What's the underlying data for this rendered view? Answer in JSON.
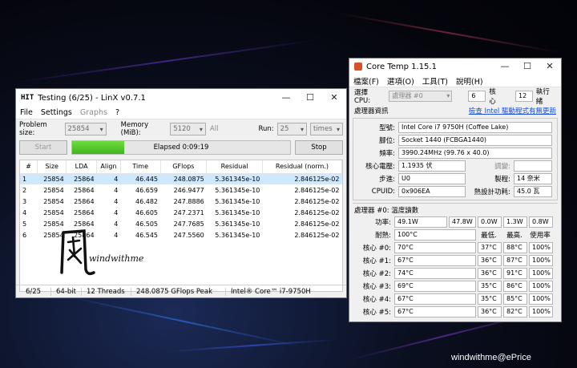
{
  "linx": {
    "title": "Testing (6/25) - LinX v0.7.1",
    "app_icon": "HIT",
    "menu": [
      "File",
      "Settings",
      "Graphs",
      "?"
    ],
    "problem_size_label": "Problem size:",
    "problem_size_value": "25854",
    "memory_label": "Memory (MiB):",
    "memory_value": "5120",
    "all_label": "All",
    "run_label": "Run:",
    "run_value": "25",
    "run_unit": "times",
    "start_label": "Start",
    "stop_label": "Stop",
    "elapsed": "Elapsed 0:09:19",
    "progress_fraction": 0.24,
    "columns": [
      "#",
      "Size",
      "LDA",
      "Align",
      "Time",
      "GFlops",
      "Residual",
      "Residual (norm.)"
    ],
    "rows": [
      [
        "1",
        "25854",
        "25864",
        "4",
        "46.445",
        "248.0875",
        "5.361345e-10",
        "2.846125e-02"
      ],
      [
        "2",
        "25854",
        "25864",
        "4",
        "46.659",
        "246.9477",
        "5.361345e-10",
        "2.846125e-02"
      ],
      [
        "3",
        "25854",
        "25864",
        "4",
        "46.482",
        "247.8886",
        "5.361345e-10",
        "2.846125e-02"
      ],
      [
        "4",
        "25854",
        "25864",
        "4",
        "46.605",
        "247.2371",
        "5.361345e-10",
        "2.846125e-02"
      ],
      [
        "5",
        "25854",
        "25864",
        "4",
        "46.505",
        "247.7685",
        "5.361345e-10",
        "2.846125e-02"
      ],
      [
        "6",
        "25854",
        "25864",
        "4",
        "46.545",
        "247.5560",
        "5.361345e-10",
        "2.846125e-02"
      ]
    ],
    "watermark_text": "windwithme",
    "status": [
      "6/25",
      "64-bit",
      "12 Threads",
      "248.0875 GFlops Peak",
      "Intel® Core™ i7-9750H"
    ]
  },
  "coretemp": {
    "title": "Core Temp 1.15.1",
    "menu": [
      "檔案(F)",
      "選項(O)",
      "工具(T)",
      "說明(H)"
    ],
    "select_cpu_label": "選擇 CPU:",
    "processor_select": "處理器 #0",
    "cores_value": "6",
    "cores_label": "核心",
    "threads_value": "12",
    "threads_label": "執行緒",
    "info_title": "處理器資訊",
    "driver_link": "檢查 Intel 驅動程式有無更新",
    "model_label": "型號:",
    "model_value": "Intel Core i7 9750H (Coffee Lake)",
    "platform_label": "腳位:",
    "platform_value": "Socket 1440 (FCBGA1440)",
    "frequency_label": "頻率:",
    "frequency_value": "3990.24MHz (99.76 x 40.0)",
    "vid_label": "核心電壓:",
    "vid_value": "1.1935 伏",
    "modulation_label": "調變:",
    "modulation_value": "",
    "revision_label": "步進:",
    "revision_value": "U0",
    "lithography_label": "製程:",
    "lithography_value": "14 奈米",
    "cpuid_label": "CPUID:",
    "cpuid_value": "0x906EA",
    "tdp_label": "熱設計功耗:",
    "tdp_value": "45.0 瓦",
    "temp_title": "處理器 #0: 溫度讀數",
    "power_label": "功率:",
    "power_values": [
      "49.1W",
      "47.8W",
      "0.0W",
      "1.3W",
      "0.8W"
    ],
    "tjmax_label": "耐熱:",
    "tjmax_value": "100°C",
    "min_header": "最低.",
    "max_header": "最高.",
    "load_header": "使用率",
    "cores": [
      {
        "label": "核心 #0:",
        "temp": "70°C",
        "min": "37°C",
        "max": "88°C",
        "load": "100%"
      },
      {
        "label": "核心 #1:",
        "temp": "67°C",
        "min": "36°C",
        "max": "87°C",
        "load": "100%"
      },
      {
        "label": "核心 #2:",
        "temp": "74°C",
        "min": "36°C",
        "max": "91°C",
        "load": "100%"
      },
      {
        "label": "核心 #3:",
        "temp": "69°C",
        "min": "35°C",
        "max": "86°C",
        "load": "100%"
      },
      {
        "label": "核心 #4:",
        "temp": "67°C",
        "min": "35°C",
        "max": "85°C",
        "load": "100%"
      },
      {
        "label": "核心 #5:",
        "temp": "67°C",
        "min": "36°C",
        "max": "82°C",
        "load": "100%"
      }
    ]
  },
  "credit": "windwithme@ePrice"
}
